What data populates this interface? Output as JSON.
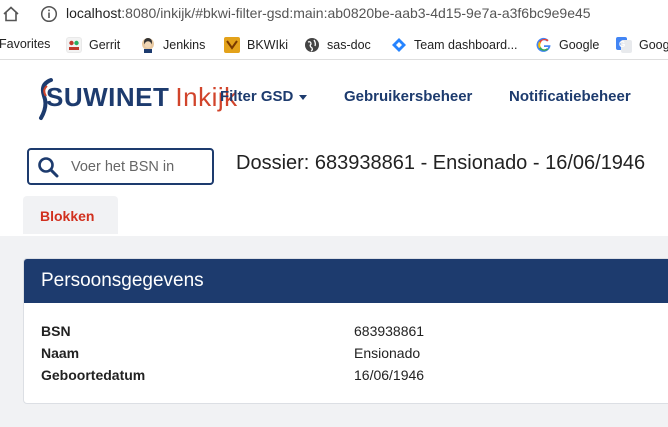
{
  "browser": {
    "url_host": "localhost",
    "url_rest": ":8080/inkijk/#bkwi-filter-gsd:main:ab0820be-aab3-4d15-9e7a-a3f6bc9e9e45"
  },
  "bookmarks": [
    {
      "label": "Favorites",
      "icon": "favorites-icon",
      "color": "#ffffff"
    },
    {
      "label": "Gerrit",
      "icon": "gerrit-icon",
      "color": "#c0392b"
    },
    {
      "label": "Jenkins",
      "icon": "jenkins-icon",
      "color": "#d9b38c"
    },
    {
      "label": "BKWIki",
      "icon": "bkwiki-icon",
      "color": "#e3a21a"
    },
    {
      "label": "sas-doc",
      "icon": "globe-icon",
      "color": "#444444"
    },
    {
      "label": "Team dashboard...",
      "icon": "jira-icon",
      "color": "#2684ff"
    },
    {
      "label": "Google",
      "icon": "google-icon",
      "color": "#4285f4"
    },
    {
      "label": "Goog",
      "icon": "google-translate-icon",
      "color": "#4285f4"
    }
  ],
  "app": {
    "logo_main": "SUWINET",
    "logo_sub": "Inkijk",
    "nav": {
      "filter": "Filter GSD",
      "users": "Gebruikersbeheer",
      "notifications": "Notificatiebeheer"
    }
  },
  "search": {
    "placeholder": "Voer het BSN in",
    "value": ""
  },
  "dossier": {
    "title": "Dossier: 683938861 - Ensionado - 16/06/1946"
  },
  "tabs": {
    "blokken": "Blokken"
  },
  "persoon": {
    "header": "Persoonsgegevens",
    "rows": [
      {
        "label": "BSN",
        "value": "683938861"
      },
      {
        "label": "Naam",
        "value": "Ensionado"
      },
      {
        "label": "Geboortedatum",
        "value": "16/06/1946"
      }
    ]
  },
  "colors": {
    "brand": "#1d3b6e",
    "accent": "#d1301e"
  }
}
